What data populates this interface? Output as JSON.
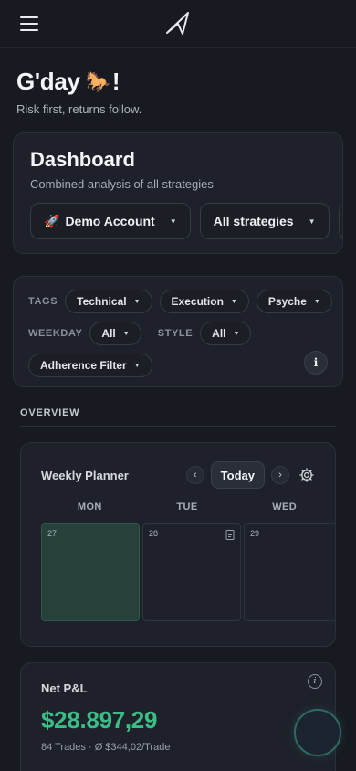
{
  "header": {
    "menu_icon": "hamburger-menu-icon",
    "logo_icon": "paper-plane-logo-icon"
  },
  "greeting": {
    "title": "G'day",
    "emoji": "🐎",
    "exclaim": "!",
    "subtitle": "Risk first, returns follow."
  },
  "dashboard": {
    "title": "Dashboard",
    "subtitle": "Combined analysis of all strategies",
    "account_emoji": "🚀",
    "account_label": "Demo Account",
    "strategy_label": "All strategies"
  },
  "filters": {
    "tags_label": "TAGS",
    "tags": [
      "Technical",
      "Execution",
      "Psyche"
    ],
    "weekday_label": "WEEKDAY",
    "weekday_value": "All",
    "style_label": "STYLE",
    "style_value": "All",
    "adherence_label": "Adherence Filter",
    "info_icon": "info-icon"
  },
  "overview": {
    "section_title": "OVERVIEW"
  },
  "planner": {
    "title": "Weekly Planner",
    "prev": "‹",
    "today_label": "Today",
    "next": "›",
    "days": [
      "MON",
      "TUE",
      "WED"
    ],
    "dates": [
      "27",
      "28",
      "29"
    ]
  },
  "pnl": {
    "title": "Net P&L",
    "value": "$28.897,29",
    "subtitle": "84 Trades · Ø $344,02/Trade",
    "value_color": "#3bbd86"
  }
}
